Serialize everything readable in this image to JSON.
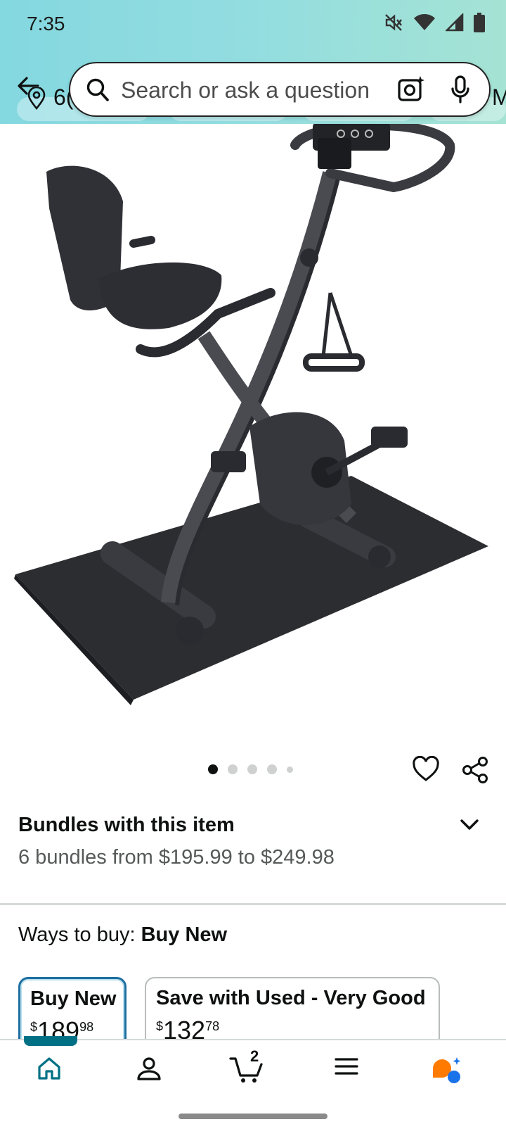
{
  "status_bar": {
    "time": "7:35",
    "icons": [
      "mute-icon",
      "wifi-icon",
      "signal-icon",
      "battery-icon"
    ]
  },
  "header": {
    "location_prefix": "6(",
    "right_clip": "M",
    "search": {
      "placeholder": "Search or ask a question"
    },
    "icons": [
      "back-arrow-icon",
      "location-pin-icon",
      "search-icon",
      "camera-lens-icon",
      "microphone-icon"
    ]
  },
  "product": {
    "image_alt": "Folding exercise bike on mat",
    "carousel": {
      "total": 5,
      "active_index": 0
    }
  },
  "bundles": {
    "title": "Bundles with this item",
    "subtitle": "6 bundles from $195.99 to $249.98"
  },
  "ways_to_buy": {
    "label": "Ways to buy:",
    "selected": "Buy New",
    "options": [
      {
        "title": "Buy New",
        "currency": "$",
        "whole": "189",
        "fraction": "98",
        "selected": true
      },
      {
        "title": "Save with Used - Very Good",
        "currency": "$",
        "whole": "132",
        "fraction": "78",
        "selected": false
      }
    ]
  },
  "bottom_nav": {
    "items": [
      "home-icon",
      "account-icon",
      "cart-icon",
      "menu-icon",
      "rufus-assistant-icon"
    ],
    "cart_count": "2"
  },
  "colors": {
    "header_gradient_start": "#84d8e0",
    "header_gradient_end": "#a5e3d4",
    "accent_teal": "#007185",
    "selected_border": "#1e6fa0",
    "rufus_orange": "#ff7a00",
    "rufus_blue": "#1a73e8"
  }
}
